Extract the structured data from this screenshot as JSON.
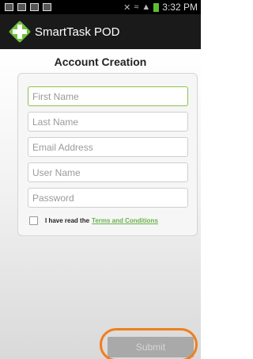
{
  "status_bar": {
    "time": "3:32 PM"
  },
  "app": {
    "title": "SmartTask POD",
    "logo_color": "#6fc13d"
  },
  "form": {
    "heading": "Account Creation",
    "fields": [
      {
        "placeholder": "First Name",
        "value": ""
      },
      {
        "placeholder": "Last Name",
        "value": ""
      },
      {
        "placeholder": "Email Address",
        "value": ""
      },
      {
        "placeholder": "User Name",
        "value": ""
      },
      {
        "placeholder": "Password",
        "value": ""
      }
    ],
    "terms_prefix": "I have read the",
    "terms_link": "Terms and Conditions",
    "terms_checked": false,
    "submit_label": "Submit"
  },
  "colors": {
    "accent_green": "#8bc34a",
    "link_green": "#6ab04c",
    "highlight_orange": "#f07f1d"
  }
}
